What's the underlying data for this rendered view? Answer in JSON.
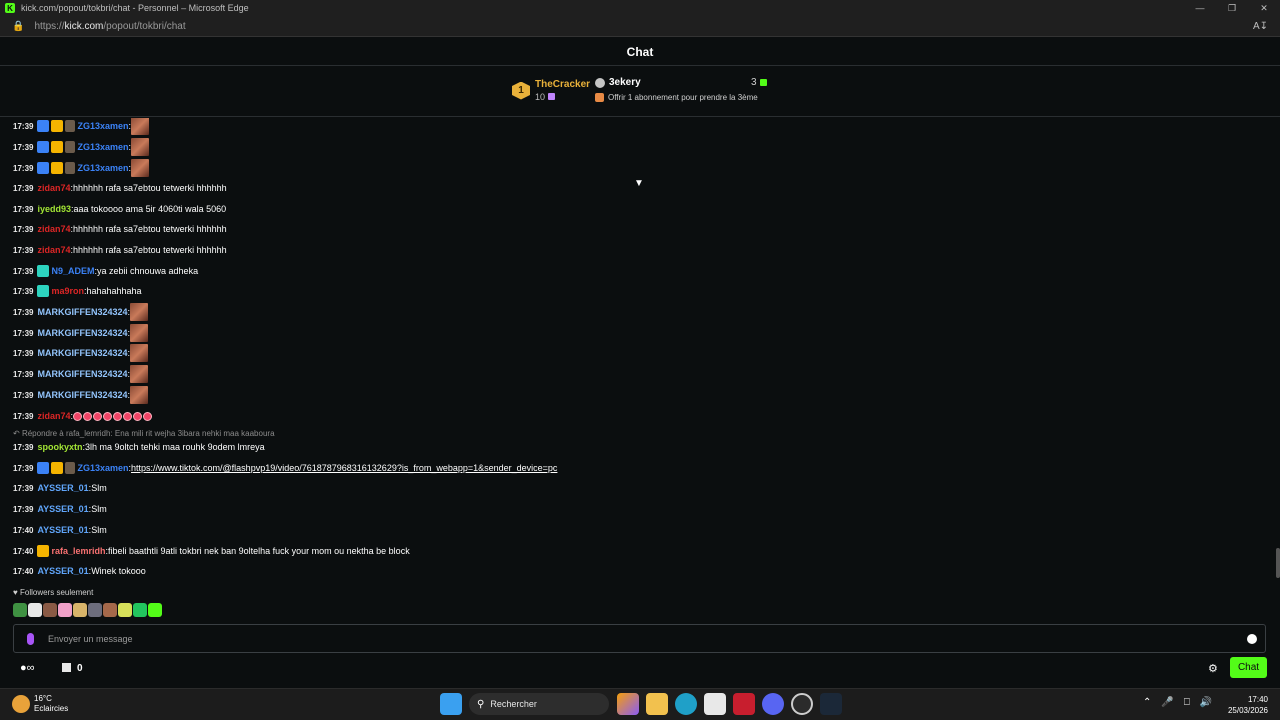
{
  "window": {
    "title": "kick.com/popout/tokbri/chat - Personnel – Microsoft Edge",
    "url_prefix": "https://",
    "url_host": "kick.com",
    "url_path": "/popout/tokbri/chat"
  },
  "header": {
    "title": "Chat"
  },
  "leaderboard": {
    "rank": "1",
    "top_name": "TheCracker",
    "top_count": "10",
    "second_name": "3ekery",
    "second_hint": "Offrir 1 abonnement pour prendre la 3ème",
    "right_count": "3"
  },
  "messages": [
    {
      "time": "17:39",
      "user": "ZG13xamen",
      "color": "#3b82f6",
      "badges": [
        "sub",
        "crown",
        "fig"
      ],
      "text": "",
      "emote": true
    },
    {
      "time": "17:39",
      "user": "ZG13xamen",
      "color": "#3b82f6",
      "badges": [
        "sub",
        "crown",
        "fig"
      ],
      "text": "",
      "emote": true
    },
    {
      "time": "17:39",
      "user": "ZG13xamen",
      "color": "#3b82f6",
      "badges": [
        "sub",
        "crown",
        "fig"
      ],
      "text": "",
      "emote": true
    },
    {
      "time": "17:39",
      "user": "zidan74",
      "color": "#dc2626",
      "badges": [],
      "text": "hhhhhh rafa sa7ebtou tetwerki hhhhhh"
    },
    {
      "time": "17:39",
      "user": "iyedd93",
      "color": "#a3e635",
      "badges": [],
      "text": "aaa tokoooo ama 5ir 4060ti wala 5060"
    },
    {
      "time": "17:39",
      "user": "zidan74",
      "color": "#dc2626",
      "badges": [],
      "text": "hhhhhh rafa sa7ebtou tetwerki hhhhhh"
    },
    {
      "time": "17:39",
      "user": "zidan74",
      "color": "#dc2626",
      "badges": [],
      "text": "hhhhhh rafa sa7ebtou tetwerki hhhhhh"
    },
    {
      "time": "17:39",
      "user": "N9_ADEM",
      "color": "#3b82f6",
      "badges": [
        "teal"
      ],
      "text": "ya zebii chnouwa adheka"
    },
    {
      "time": "17:39",
      "user": "ma9ron",
      "color": "#dc2626",
      "badges": [
        "teal"
      ],
      "text": "hahahahhaha"
    },
    {
      "time": "17:39",
      "user": "MARKGIFFEN324324",
      "color": "#93c5fd",
      "badges": [],
      "text": "",
      "emote": true
    },
    {
      "time": "17:39",
      "user": "MARKGIFFEN324324",
      "color": "#93c5fd",
      "badges": [],
      "text": "",
      "emote": true
    },
    {
      "time": "17:39",
      "user": "MARKGIFFEN324324",
      "color": "#93c5fd",
      "badges": [],
      "text": "",
      "emote": true
    },
    {
      "time": "17:39",
      "user": "MARKGIFFEN324324",
      "color": "#93c5fd",
      "badges": [],
      "text": "",
      "emote": true
    },
    {
      "time": "17:39",
      "user": "MARKGIFFEN324324",
      "color": "#93c5fd",
      "badges": [],
      "text": "",
      "emote": true
    },
    {
      "time": "17:39",
      "user": "zidan74",
      "color": "#dc2626",
      "badges": [],
      "text": "",
      "emojis": 8
    },
    {
      "time": "17:39",
      "user": "spookyxtn",
      "color": "#a3e635",
      "badges": [],
      "text": "3lh ma 9oltch tehki maa rouhk 9odem lmreya"
    },
    {
      "time": "17:39",
      "user": "ZG13xamen",
      "color": "#3b82f6",
      "badges": [
        "sub",
        "crown",
        "fig"
      ],
      "text": "https://www.tiktok.com/@flashpvp19/video/7618787968316132629?is_from_webapp=1&sender_device=pc",
      "link": true
    },
    {
      "time": "17:39",
      "user": "AYSSER_01",
      "color": "#60a5fa",
      "badges": [],
      "text": "Slm"
    },
    {
      "time": "17:39",
      "user": "AYSSER_01",
      "color": "#60a5fa",
      "badges": [],
      "text": "Slm"
    },
    {
      "time": "17:40",
      "user": "AYSSER_01",
      "color": "#60a5fa",
      "badges": [],
      "text": "Slm"
    },
    {
      "time": "17:40",
      "user": "rafa_lemridh",
      "color": "#f87171",
      "badges": [
        "crown"
      ],
      "text": "fibeli baathtli 9atli tokbri nek ban 9oltelha fuck your mom ou nektha be block"
    },
    {
      "time": "17:40",
      "user": "AYSSER_01",
      "color": "#60a5fa",
      "badges": [],
      "text": "Winek tokooo"
    }
  ],
  "reply_line": "Répondre à rafa_lemridh: Ena mili rit wejha 3ibara nehki maa kaaboura",
  "followers_only": "Followers seulement",
  "input": {
    "placeholder": "Envoyer un message"
  },
  "bottom": {
    "points": "0",
    "send_label": "Chat"
  },
  "taskbar": {
    "temp": "16°C",
    "weather": "Eclaircies",
    "search_label": "Rechercher",
    "time": "17:40",
    "date": "25/03/2026"
  },
  "colors": {
    "accent": "#53fc18",
    "background": "#0b0e0f",
    "gold": "#e9b13a"
  }
}
